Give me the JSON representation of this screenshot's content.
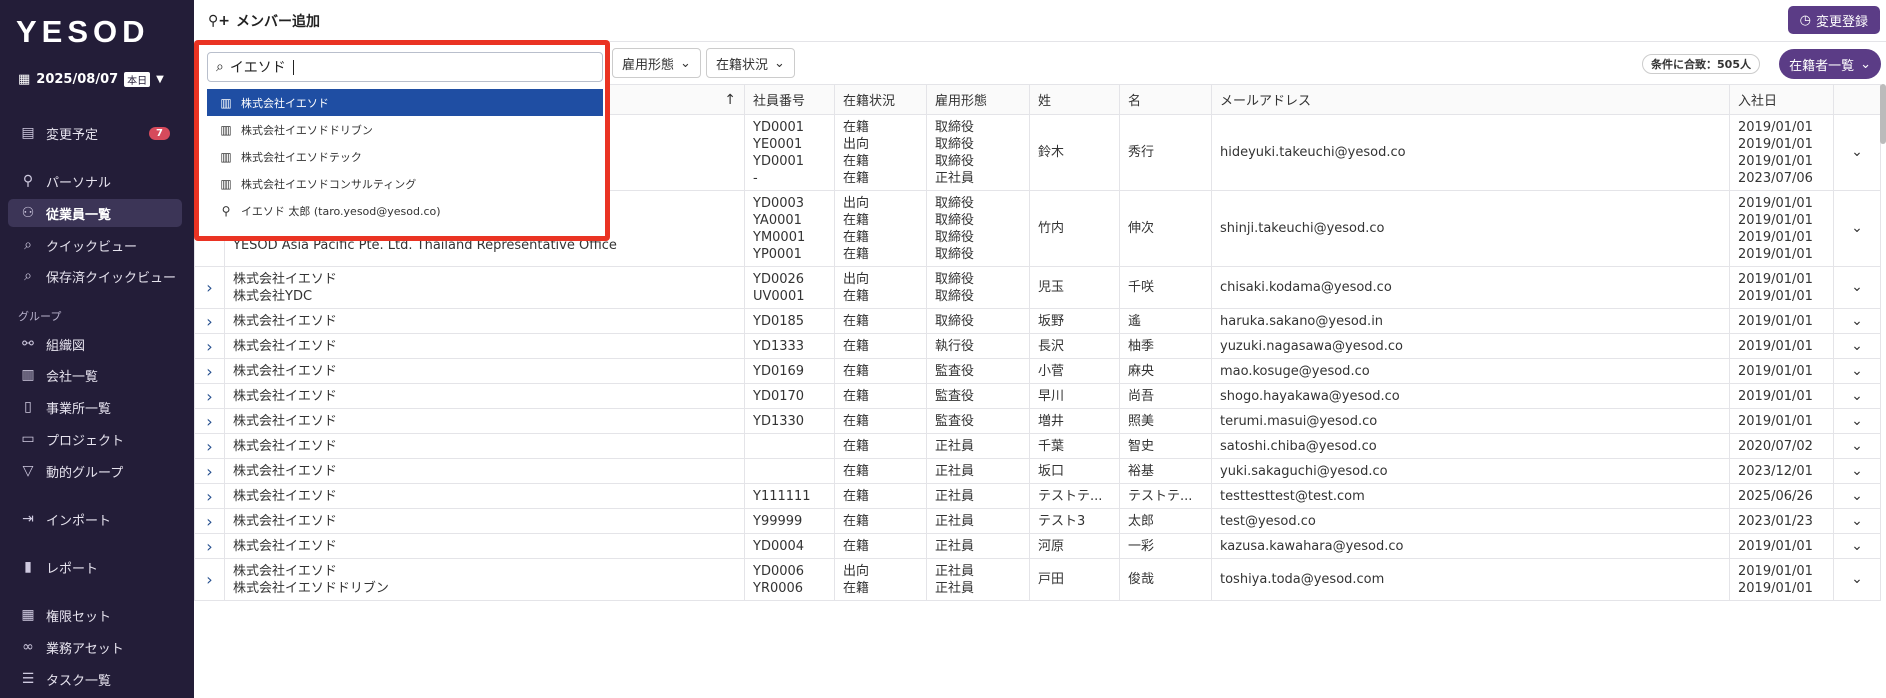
{
  "sidebar": {
    "logo": "YESOD",
    "date": "2025/08/07",
    "today_label": "本日",
    "items": [
      {
        "label": "変更予定",
        "icon": "clipboard-icon",
        "badge": "7"
      },
      {
        "label": "パーソナル",
        "icon": "person-icon"
      },
      {
        "label": "従業員一覧",
        "icon": "people-icon",
        "active": true
      },
      {
        "label": "クイックビュー",
        "icon": "search-icon"
      },
      {
        "label": "保存済クイックビュー",
        "icon": "search-icon"
      },
      {
        "label": "組織図",
        "icon": "org-chart-icon"
      },
      {
        "label": "会社一覧",
        "icon": "company-icon"
      },
      {
        "label": "事業所一覧",
        "icon": "building-icon"
      },
      {
        "label": "プロジェクト",
        "icon": "briefcase-icon"
      },
      {
        "label": "動的グループ",
        "icon": "filter-icon"
      },
      {
        "label": "インポート",
        "icon": "import-icon"
      },
      {
        "label": "レポート",
        "icon": "bar-chart-icon"
      },
      {
        "label": "権限セット",
        "icon": "grid-icon"
      },
      {
        "label": "業務アセット",
        "icon": "link-icon"
      },
      {
        "label": "タスク一覧",
        "icon": "task-list-icon"
      }
    ],
    "group_label": "グループ"
  },
  "header": {
    "add_member": "メンバー追加",
    "change_register": "変更登録"
  },
  "toolbar": {
    "employment_filter": "雇用形態",
    "status_filter": "在籍状況",
    "count_label": "条件に合致：505人",
    "list_button": "在籍者一覧"
  },
  "table": {
    "headers": [
      "",
      "社員番号",
      "在籍状況",
      "雇用形態",
      "姓",
      "名",
      "メールアドレス",
      "入社日"
    ],
    "rows": [
      {
        "company": "",
        "ids": "YD0001\nYE0001\nYD0001\n-",
        "status": "在籍\n出向\n在籍\n在籍",
        "type": "取締役\n取締役\n取締役\n正社員",
        "last": "鈴木",
        "first": "秀行",
        "email": "hideyuki.takeuchi@yesod.co",
        "date": "2019/01/01\n2019/01/01\n2019/01/01\n2023/07/06"
      },
      {
        "company": "株式会社イエ\n株式会社イエソドコンサルティング\nYESOD Asia Pacific Pte. Ltd. Thailand Representative Office",
        "ids": "YD0003\nYA0001\nYM0001\nYP0001",
        "status": "出向\n在籍\n在籍\n在籍",
        "type": "取締役\n取締役\n取締役\n取締役",
        "last": "竹内",
        "first": "伸次",
        "email": "shinji.takeuchi@yesod.co",
        "date": "2019/01/01\n2019/01/01\n2019/01/01\n2019/01/01"
      },
      {
        "company": "株式会社イエソド\n株式会社YDC",
        "ids": "YD0026\nUV0001",
        "status": "出向\n在籍",
        "type": "取締役\n取締役",
        "last": "児玉",
        "first": "千咲",
        "email": "chisaki.kodama@yesod.co",
        "date": "2019/01/01\n2019/01/01"
      },
      {
        "company": "株式会社イエソド",
        "ids": "YD0185",
        "status": "在籍",
        "type": "取締役",
        "last": "坂野",
        "first": "遙",
        "email": "haruka.sakano@yesod.in",
        "date": "2019/01/01"
      },
      {
        "company": "株式会社イエソド",
        "ids": "YD1333",
        "status": "在籍",
        "type": "執行役",
        "last": "長沢",
        "first": "柚季",
        "email": "yuzuki.nagasawa@yesod.co",
        "date": "2019/01/01"
      },
      {
        "company": "株式会社イエソド",
        "ids": "YD0169",
        "status": "在籍",
        "type": "監査役",
        "last": "小菅",
        "first": "麻央",
        "email": "mao.kosuge@yesod.co",
        "date": "2019/01/01"
      },
      {
        "company": "株式会社イエソド",
        "ids": "YD0170",
        "status": "在籍",
        "type": "監査役",
        "last": "早川",
        "first": "尚吾",
        "email": "shogo.hayakawa@yesod.co",
        "date": "2019/01/01"
      },
      {
        "company": "株式会社イエソド",
        "ids": "YD1330",
        "status": "在籍",
        "type": "監査役",
        "last": "増井",
        "first": "照美",
        "email": "terumi.masui@yesod.co",
        "date": "2019/01/01"
      },
      {
        "company": "株式会社イエソド",
        "ids": "",
        "status": "在籍",
        "type": "正社員",
        "last": "千葉",
        "first": "智史",
        "email": "satoshi.chiba@yesod.co",
        "date": "2020/07/02"
      },
      {
        "company": "株式会社イエソド",
        "ids": "",
        "status": "在籍",
        "type": "正社員",
        "last": "坂口",
        "first": "裕基",
        "email": "yuki.sakaguchi@yesod.co",
        "date": "2023/12/01"
      },
      {
        "company": "株式会社イエソド",
        "ids": "Y111111",
        "status": "在籍",
        "type": "正社員",
        "last": "テストテ...",
        "first": "テストテ...",
        "email": "testtesttest@test.com",
        "date": "2025/06/26"
      },
      {
        "company": "株式会社イエソド",
        "ids": "Y99999",
        "status": "在籍",
        "type": "正社員",
        "last": "テスト3",
        "first": "太郎",
        "email": "test@yesod.co",
        "date": "2023/01/23"
      },
      {
        "company": "株式会社イエソド",
        "ids": "YD0004",
        "status": "在籍",
        "type": "正社員",
        "last": "河原",
        "first": "一彩",
        "email": "kazusa.kawahara@yesod.co",
        "date": "2019/01/01"
      },
      {
        "company": "株式会社イエソド\n株式会社イエソドドリブン",
        "ids": "YD0006\nYR0006",
        "status": "出向\n在籍",
        "type": "正社員\n正社員",
        "last": "戸田",
        "first": "俊哉",
        "email": "toshiya.toda@yesod.com",
        "date": "2019/01/01\n2019/01/01"
      }
    ]
  },
  "dropdown": {
    "search_value": "イエソド",
    "options": [
      {
        "label": "株式会社イエソド",
        "icon": "company-icon",
        "selected": true
      },
      {
        "label": "株式会社イエソドドリブン",
        "icon": "company-icon"
      },
      {
        "label": "株式会社イエソドテック",
        "icon": "company-icon"
      },
      {
        "label": "株式会社イエソドコンサルティング",
        "icon": "company-icon"
      },
      {
        "label": "イエソド 太郎 (taro.yesod@yesod.co)",
        "icon": "person-icon"
      }
    ]
  },
  "colors": {
    "sidebar_bg": "#231d38",
    "accent": "#5b3c86",
    "selected_option": "#1f4ea3",
    "highlight_border": "#ea3323",
    "badge": "#d64a5c"
  }
}
